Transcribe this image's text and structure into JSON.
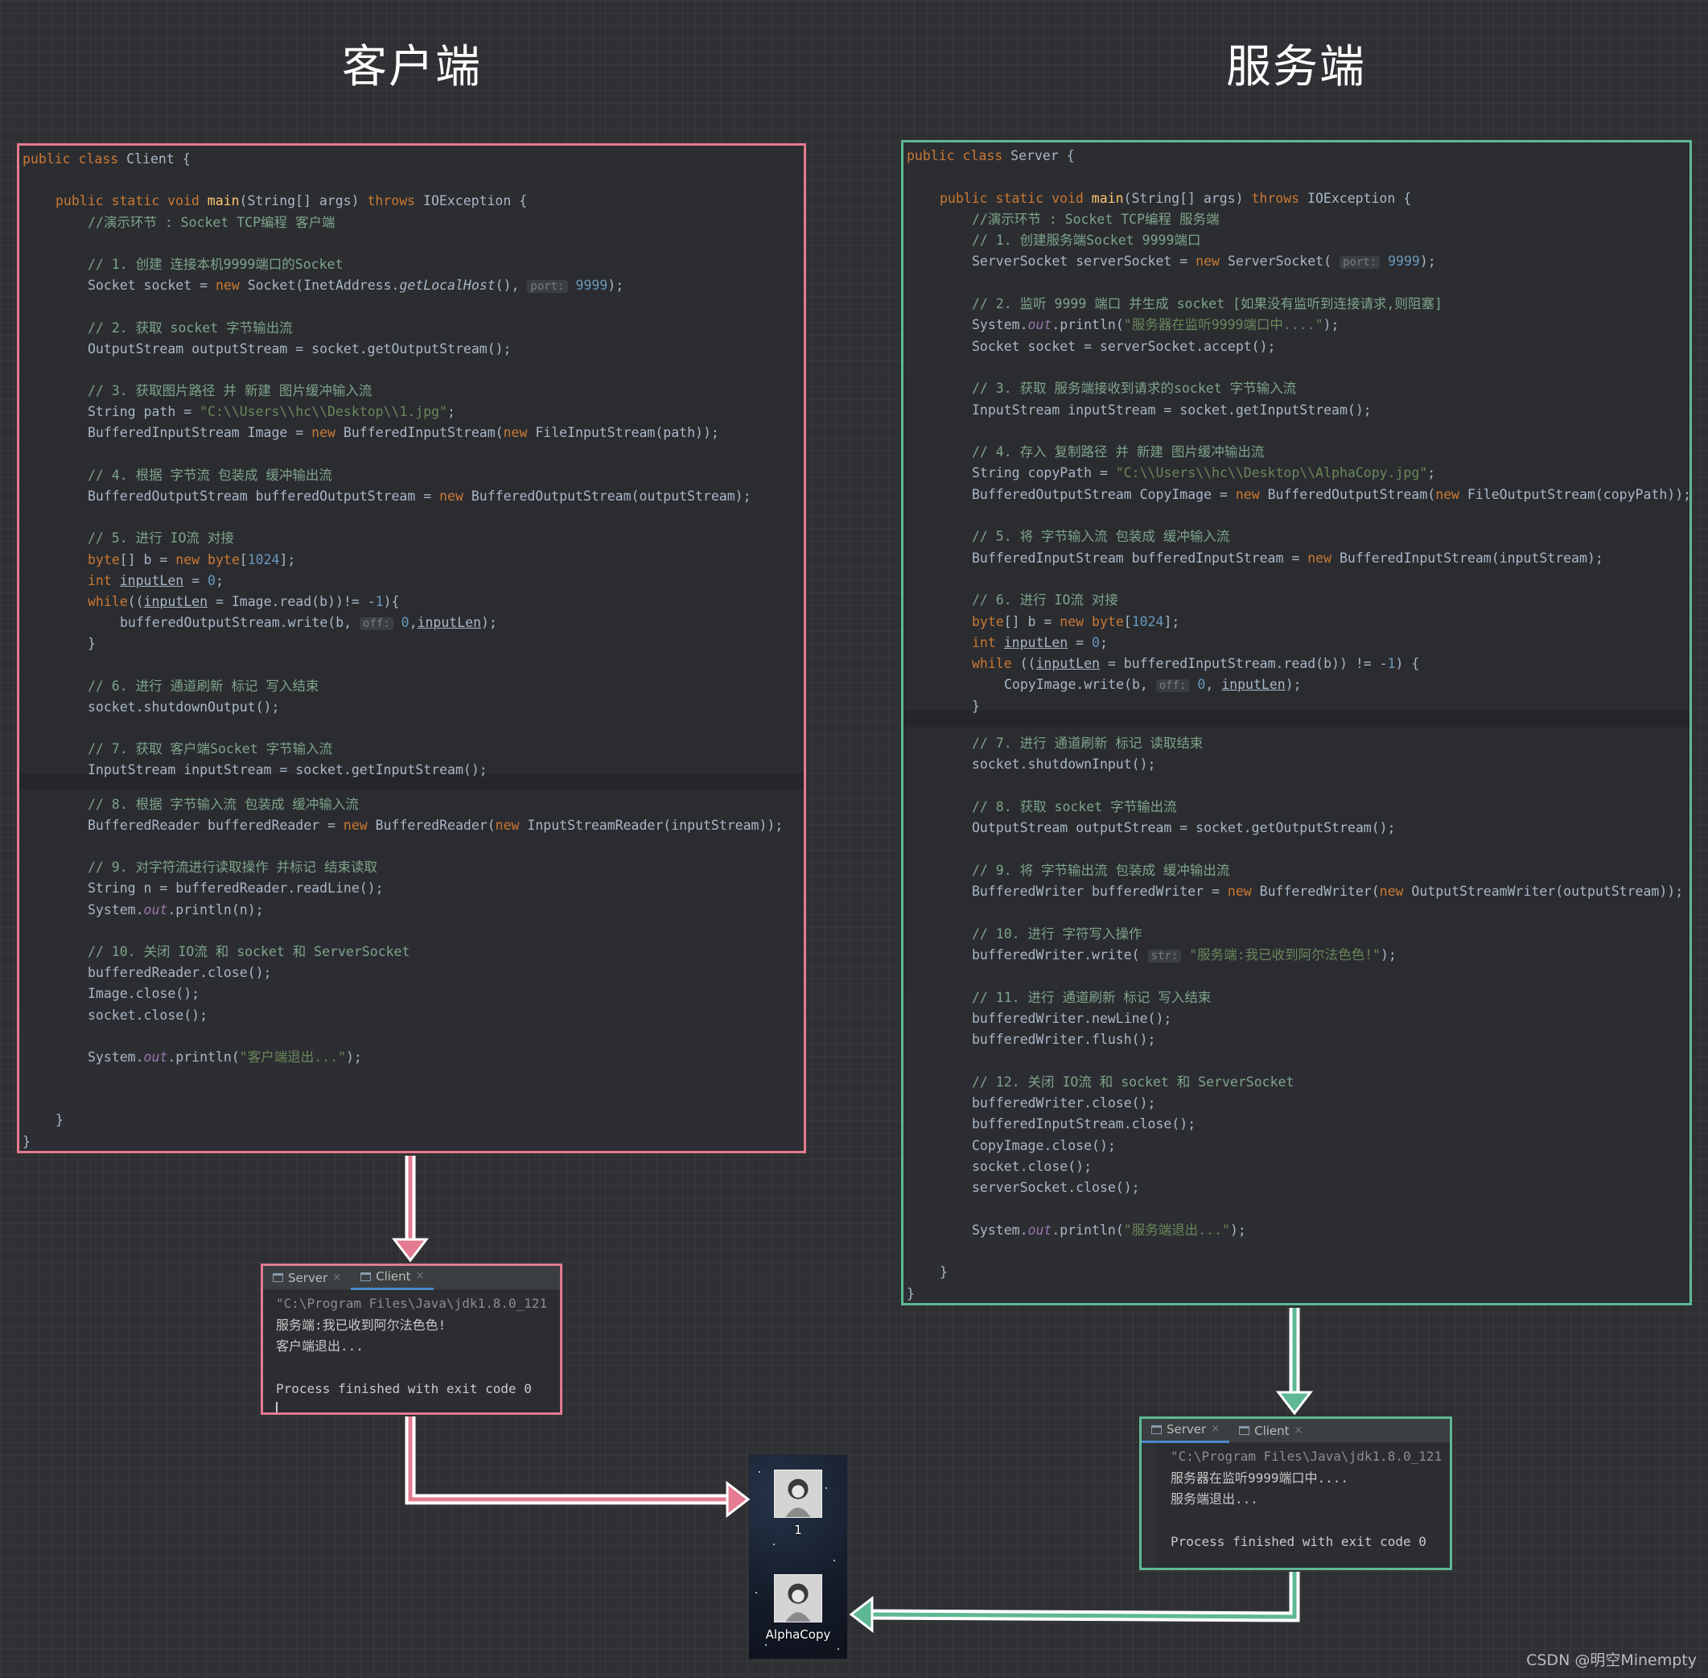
{
  "headings": {
    "client": "客户端",
    "server": "服务端"
  },
  "colors": {
    "client_accent": "#e47b90",
    "server_accent": "#5eb894"
  },
  "client_code": {
    "l1": "Client {",
    "l2_sig": "(String[] args) ",
    "l2_exc": " IOException {",
    "l3": "//演示环节 : Socket TCP编程 客户端",
    "l4": "// 1. 创建 连接本机9999端口的Socket",
    "l5a": "Socket socket = ",
    "l5b": " Socket(InetAddress.",
    "l5c": "getLocalHost",
    "l5d": "(), ",
    "l5hint": "port:",
    "l5num": "9999",
    "l5e": ");",
    "l6": "// 2. 获取 socket 字节输出流",
    "l7": "OutputStream outputStream = socket.getOutputStream();",
    "l8": "// 3. 获取图片路径 并 新建 图片缓冲输入流",
    "l9a": "String path = ",
    "l9str": "\"C:\\\\Users\\\\hc\\\\Desktop\\\\1.jpg\"",
    "l9b": ";",
    "l10a": "BufferedInputStream Image = ",
    "l10b": " BufferedInputStream(",
    "l10c": " FileInputStream(path));",
    "l11": "// 4. 根据 字节流 包装成 缓冲输出流",
    "l12a": "BufferedOutputStream bufferedOutputStream = ",
    "l12b": " BufferedOutputStream(outputStream);",
    "l13": "// 5. 进行 IO流 对接",
    "l14a": "[] b = ",
    "l14b": "[",
    "l14num": "1024",
    "l14c": "];",
    "l15a": "inputLen",
    "l15b": " = ",
    "l15num": "0",
    "l15c": ";",
    "l16a": "((",
    "l16b": "inputLen",
    "l16c": " = Image.read(b))!= -",
    "l16num": "1",
    "l16d": "){",
    "l17a": "bufferedOutputStream.write(b, ",
    "l17hint": "off:",
    "l17num": "0",
    "l17b": ",",
    "l17c": "inputLen",
    "l17d": ");",
    "l18": "}",
    "l19": "// 6. 进行 通道刷新 标记 写入结束",
    "l20": "socket.shutdownOutput();",
    "l21": "// 7. 获取 客户端Socket 字节输入流",
    "l22": "InputStream inputStream = socket.getInputStream();",
    "l23": "// 8. 根据 字节输入流 包装成 缓冲输入流",
    "l24a": "BufferedReader bufferedReader = ",
    "l24b": " BufferedReader(",
    "l24c": " InputStreamReader(inputStream));",
    "l25": "// 9. 对字符流进行读取操作 并标记 结束读取",
    "l26": "String n = bufferedReader.readLine();",
    "l27a": "System.",
    "l27b": "out",
    "l27c": ".println(n);",
    "l28": "// 10. 关闭 IO流 和 socket 和 ServerSocket",
    "l29": "bufferedReader.close();",
    "l30": "Image.close();",
    "l31": "socket.close();",
    "l32a": "System.",
    "l32b": "out",
    "l32c": ".println(",
    "l32str": "\"客户端退出...\"",
    "l32d": ");",
    "l33": "}",
    "l34": "}"
  },
  "server_code": {
    "l1": "Server {",
    "l2_sig": "(String[] args) ",
    "l2_exc": " IOException {",
    "l3": "//演示环节 : Socket TCP编程 服务端",
    "l4": "// 1. 创建服务端Socket 9999端口",
    "l5a": "ServerSocket serverSocket = ",
    "l5b": " ServerSocket( ",
    "l5hint": "port:",
    "l5num": "9999",
    "l5c": ");",
    "l6": "// 2. 监听 9999 端口 并生成 socket [如果没有监听到连接请求,则阻塞]",
    "l7a": "System.",
    "l7b": "out",
    "l7c": ".println(",
    "l7str": "\"服务器在监听9999端口中....\"",
    "l7d": ");",
    "l8": "Socket socket = serverSocket.accept();",
    "l9": "// 3. 获取 服务端接收到请求的socket 字节输入流",
    "l10": "InputStream inputStream = socket.getInputStream();",
    "l11": "// 4. 存入 复制路径 并 新建 图片缓冲输出流",
    "l12a": "String copyPath = ",
    "l12str": "\"C:\\\\Users\\\\hc\\\\Desktop\\\\AlphaCopy.jpg\"",
    "l12b": ";",
    "l13a": "BufferedOutputStream CopyImage = ",
    "l13b": " BufferedOutputStream(",
    "l13c": " FileOutputStream(copyPath));",
    "l14": "// 5. 将 字节输入流 包装成 缓冲输入流",
    "l15a": "BufferedInputStream bufferedInputStream = ",
    "l15b": " BufferedInputStream(inputStream);",
    "l16": "// 6. 进行 IO流 对接",
    "l17a": "[] b = ",
    "l17b": "[",
    "l17num": "1024",
    "l17c": "];",
    "l18a": "inputLen",
    "l18b": " = ",
    "l18num": "0",
    "l18c": ";",
    "l19a": " ((",
    "l19b": "inputLen",
    "l19c": " = bufferedInputStream.read(b)) != -",
    "l19num": "1",
    "l19d": ") {",
    "l20a": "CopyImage.write(b, ",
    "l20hint": "off:",
    "l20num": "0",
    "l20b": ", ",
    "l20c": "inputLen",
    "l20d": ");",
    "l21": "}",
    "l22": "// 7. 进行 通道刷新 标记 读取结束",
    "l23": "socket.shutdownInput();",
    "l24": "// 8. 获取 socket 字节输出流",
    "l25": "OutputStream outputStream = socket.getOutputStream();",
    "l26": "// 9. 将 字节输出流 包装成 缓冲输出流",
    "l27a": "BufferedWriter bufferedWriter = ",
    "l27b": " BufferedWriter(",
    "l27c": " OutputStreamWriter(outputStream));",
    "l28": "// 10. 进行 字符写入操作",
    "l29a": "bufferedWriter.write( ",
    "l29hint": "str:",
    "l29str": "\"服务端:我已收到阿尔法色色!\"",
    "l29b": ");",
    "l30": "// 11. 进行 通道刷新 标记 写入结束",
    "l31": "bufferedWriter.newLine();",
    "l32": "bufferedWriter.flush();",
    "l33": "// 12. 关闭 IO流 和 socket 和 ServerSocket",
    "l34": "bufferedWriter.close();",
    "l35": "bufferedInputStream.close();",
    "l36": "CopyImage.close();",
    "l37": "socket.close();",
    "l38": "serverSocket.close();",
    "l39a": "System.",
    "l39b": "out",
    "l39c": ".println(",
    "l39str": "\"服务端退出...\"",
    "l39d": ");",
    "l40": "}",
    "l41": "}"
  },
  "keywords": {
    "public": "public",
    "class": "class",
    "static": "static",
    "void": "void",
    "main": "main",
    "throws": "throws",
    "new": "new",
    "byte": "byte",
    "int": "int",
    "while": "while"
  },
  "client_console": {
    "tab_server": "Server",
    "tab_client": "Client",
    "close": "×",
    "lines": [
      "\"C:\\Program Files\\Java\\jdk1.8.0_121",
      "服务端:我已收到阿尔法色色!",
      "客户端退出...",
      "",
      "Process finished with exit code 0"
    ]
  },
  "server_console": {
    "tab_server": "Server",
    "tab_client": "Client",
    "close": "×",
    "lines": [
      "\"C:\\Program Files\\Java\\jdk1.8.0_121",
      "服务器在监听9999端口中....",
      "服务端退出...",
      "",
      "Process finished with exit code 0"
    ]
  },
  "files": [
    {
      "name": "1",
      "icon": "image-file-icon"
    },
    {
      "name": "AlphaCopy",
      "icon": "image-file-icon"
    }
  ],
  "watermark": "CSDN @明空Minempty"
}
